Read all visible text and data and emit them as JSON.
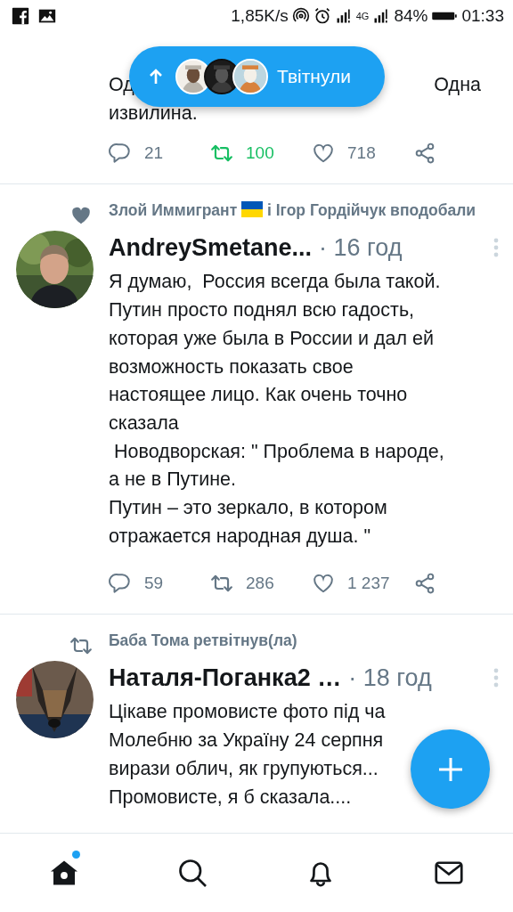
{
  "status_bar": {
    "speed": "1,85K/s",
    "network": "4G",
    "battery": "84%",
    "time": "01:33"
  },
  "new_tweets_pill": {
    "label": "Твітнули"
  },
  "tweets": [
    {
      "text_lines": [
        "Од",
        "Одна",
        "извилина."
      ],
      "actions": {
        "replies": "21",
        "retweets": "100",
        "retweeted": true,
        "likes": "718",
        "liked": false
      }
    },
    {
      "context": {
        "kind": "liked",
        "parts": [
          "Злой Иммигрант",
          "і Ігор Гордійчук вподобали"
        ]
      },
      "name": "AndreySmetane...",
      "time": "· 16 год",
      "text_lines": [
        "Я думаю,  Россия всегда была такой.",
        "Путин просто поднял всю гадость,",
        "которая уже была в России и дал ей",
        "возможность показать свое",
        "настоящее лицо. Как очень точно",
        "сказала",
        " Новодворская: \" Проблема в народе,",
        "а не в Путине.",
        "Путин – это зеркало, в котором",
        "отражается народная душа. \""
      ],
      "actions": {
        "replies": "59",
        "retweets": "286",
        "retweeted": false,
        "likes": "1 237",
        "liked": false
      }
    },
    {
      "context": {
        "kind": "retweet",
        "parts": [
          "Баба Тома ретвітнув(ла)"
        ]
      },
      "name": "Наталя-Поганка2 …",
      "time": "· 18 год",
      "text_lines": [
        "Цікаве промовисте фото під ча",
        "Молебню за Україну 24 серпня",
        "вирази облич, як групуються...",
        "Промовисте, я б сказала...."
      ]
    }
  ],
  "bottom_nav": [
    {
      "kind": "home",
      "selected": true,
      "unread": true
    },
    {
      "kind": "search",
      "selected": false,
      "unread": false
    },
    {
      "kind": "notifications",
      "selected": false,
      "unread": false
    },
    {
      "kind": "messages",
      "selected": false,
      "unread": false
    }
  ]
}
